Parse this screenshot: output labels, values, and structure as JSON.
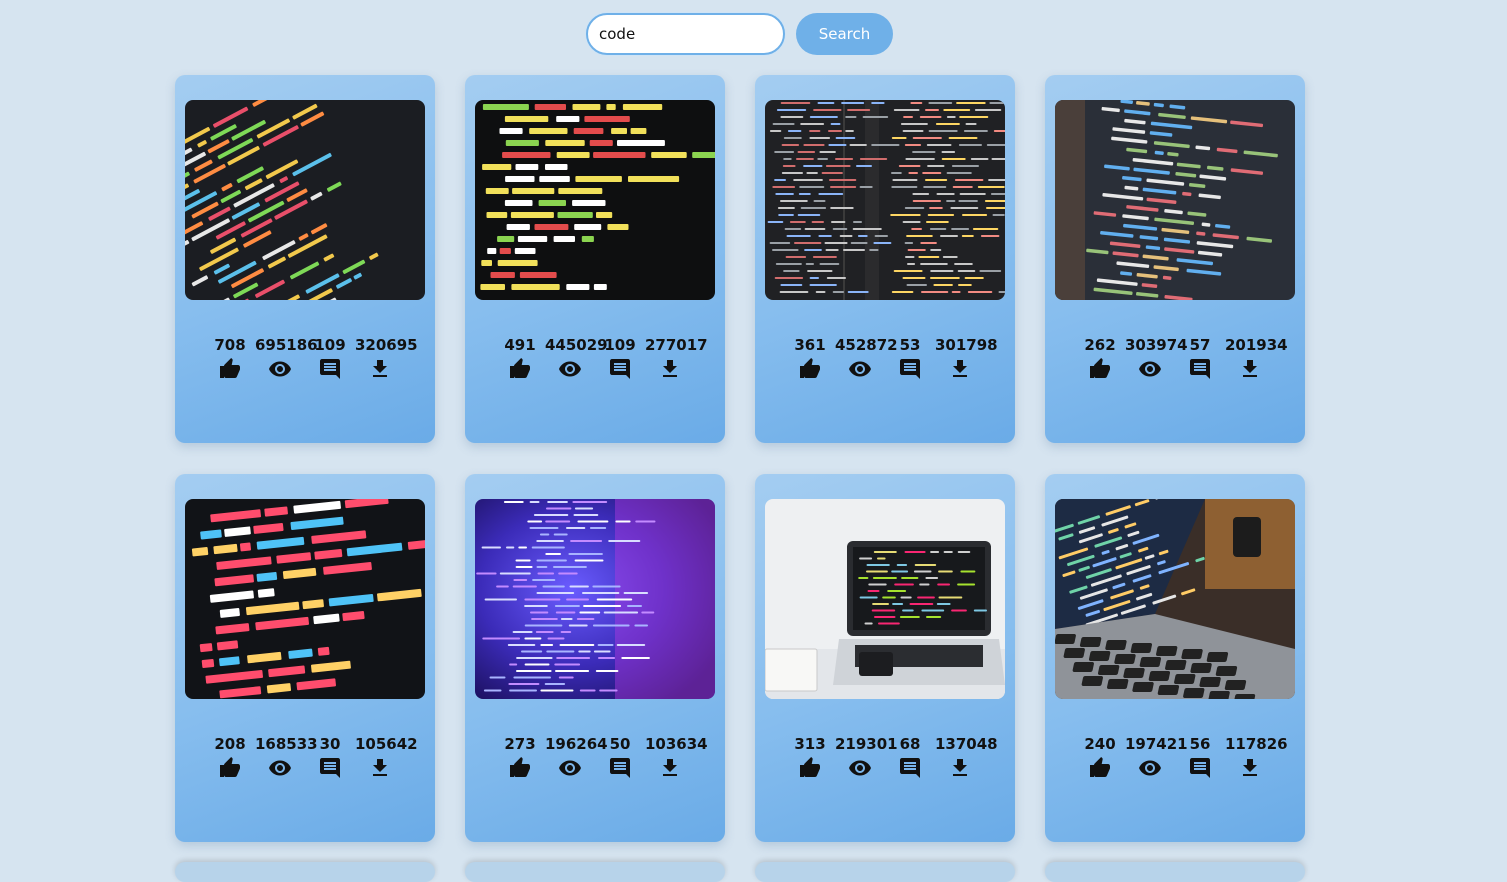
{
  "search": {
    "value": "code",
    "placeholder": "",
    "button_label": "Search"
  },
  "icons": [
    "thumb-up-icon",
    "eye-icon",
    "comment-icon",
    "download-icon"
  ],
  "cards": [
    {
      "image": "code-editor-colorful-syntax",
      "likes": "708",
      "views": "695186",
      "comments": "109",
      "downloads": "320695"
    },
    {
      "image": "html-code-on-dark-screen",
      "likes": "491",
      "views": "445029",
      "comments": "109",
      "downloads": "277017"
    },
    {
      "image": "dark-code-editor-columns",
      "likes": "361",
      "views": "452872",
      "comments": "53",
      "downloads": "301798"
    },
    {
      "image": "javascript-code-on-monitor",
      "likes": "262",
      "views": "303974",
      "comments": "57",
      "downloads": "201934"
    },
    {
      "image": "jquery-scroll-code",
      "likes": "208",
      "views": "168533",
      "comments": "30",
      "downloads": "105642"
    },
    {
      "image": "blurred-purple-code",
      "likes": "273",
      "views": "196264",
      "comments": "50",
      "downloads": "103634"
    },
    {
      "image": "laptop-on-white-desk",
      "likes": "313",
      "views": "219301",
      "comments": "68",
      "downloads": "137048"
    },
    {
      "image": "laptop-with-code-and-mug",
      "likes": "240",
      "views": "197421",
      "comments": "56",
      "downloads": "117826"
    }
  ]
}
